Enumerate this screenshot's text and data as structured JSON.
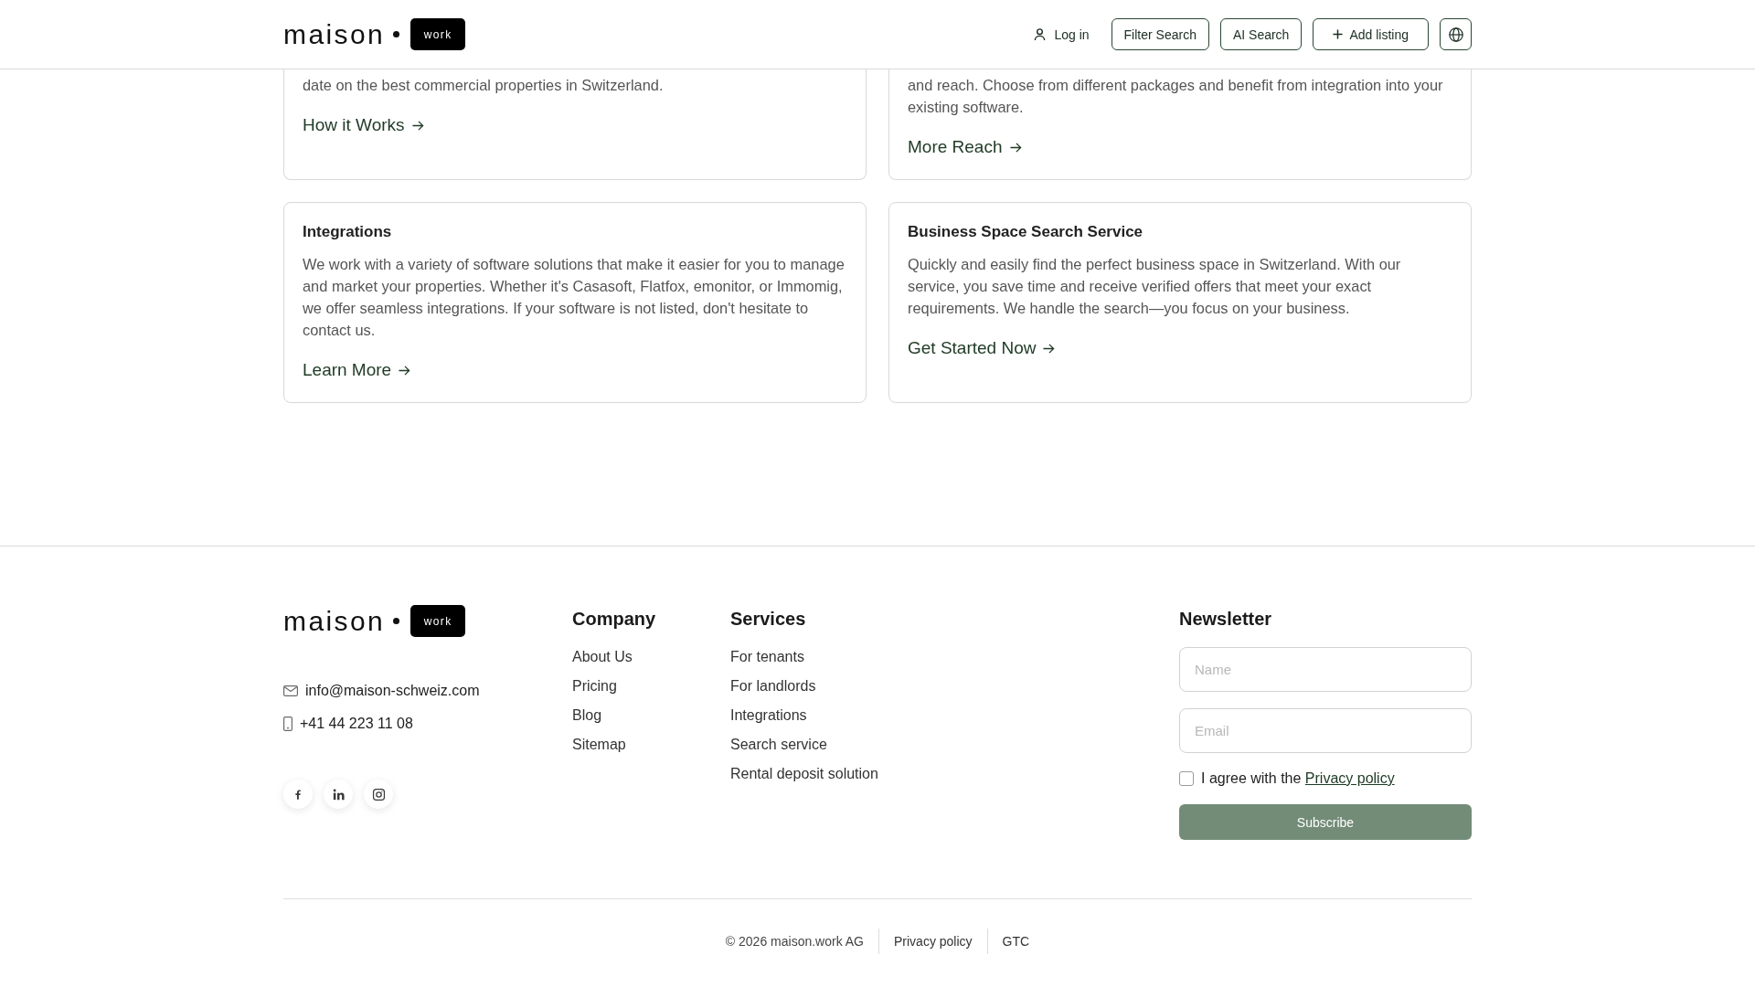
{
  "header": {
    "logo": {
      "wordmark": "maison",
      "badge": "work"
    },
    "login": {
      "label": "Log in"
    },
    "actions": [
      {
        "kind": "search",
        "label": "Filter Search"
      },
      {
        "kind": "search",
        "label": "AI Search"
      },
      {
        "kind": "add",
        "label": "Add listing"
      }
    ]
  },
  "cards": [
    {
      "kind": "clipped",
      "description": "date on the best commercial properties in Switzerland.",
      "link": "How it Works"
    },
    {
      "kind": "clipped",
      "description": "and reach. Choose from different packages and benefit from integration into your existing software.",
      "link": "More Reach"
    },
    {
      "kind": "full",
      "title": "Integrations",
      "description": "We work with a variety of software solutions that make it easier for you to manage and market your properties. Whether it's Casasoft, Flatfox, emonitor, or Immomig, we offer seamless integrations. If your software is not listed, don't hesitate to contact us.",
      "link": "Learn More"
    },
    {
      "kind": "full",
      "title": "Business Space Search Service",
      "description": "Quickly and easily find the perfect business space in Switzerland. With our service, you save time and receive verified offers that meet your exact requirements. We handle the search—you focus on your business.",
      "link": "Get Started Now"
    }
  ],
  "footer": {
    "logo": {
      "wordmark": "maison",
      "badge": "work"
    },
    "email": "info@maison-schweiz.com",
    "phone": "+41 44 223 11 08",
    "columns": [
      {
        "title": "Company",
        "links": [
          "About Us",
          "Pricing",
          "Blog",
          "Sitemap"
        ]
      },
      {
        "title": "Services",
        "links": [
          "For tenants",
          "For landlords",
          "Integrations",
          "Search service",
          "Rental deposit solution"
        ]
      }
    ],
    "newsletter": {
      "title": "Newsletter",
      "fields": [
        {
          "placeholder": "Name"
        },
        {
          "placeholder": "Email"
        }
      ],
      "consent": {
        "checked": false,
        "text": "I agree with the",
        "link": "Privacy policy"
      },
      "button": "Subscribe"
    },
    "bottom": {
      "copyright": "© 2026 maison.work AG",
      "links": [
        "Privacy policy",
        "GTC"
      ]
    }
  }
}
